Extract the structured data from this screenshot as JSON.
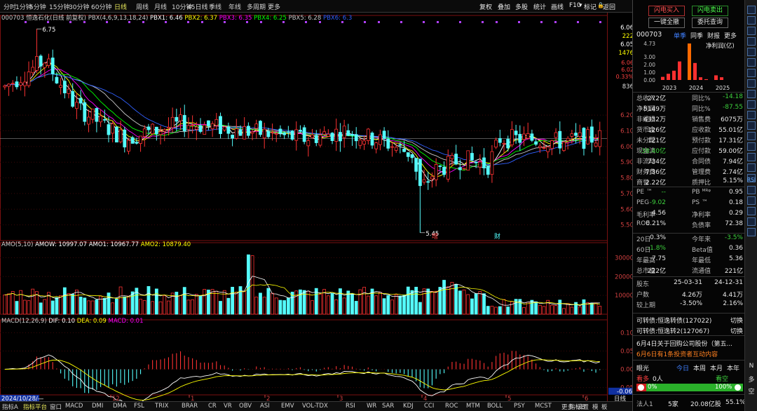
{
  "toolbar": {
    "periods": [
      "分时",
      "1分钟",
      "5分钟",
      "15分钟",
      "30分钟",
      "60分钟",
      "日线",
      "周线",
      "月线",
      "10分钟",
      "45日线",
      "季线",
      "年线",
      "多周期",
      "更多"
    ],
    "active_period": "日线",
    "right_buttons": [
      "复权",
      "叠加",
      "多股",
      "统计",
      "画线",
      "F10",
      "标记",
      "返回"
    ],
    "lock_icon": "lock-icon",
    "f10_dropdown": "▾"
  },
  "price_legend": {
    "stock": "000703 恒逸石化(日线 前复权)",
    "indicator": "PBX(4,6,9,13,18,24)",
    "pbx1": "PBX1: 6.46",
    "pbx2": "PBX2: 6.37",
    "pbx3": "PBX3: 6.35",
    "pbx4": "PBX4: 6.25",
    "pbx5": "PBX5: 6.28",
    "pbx6": "PBX6: 6.3"
  },
  "price_axis": {
    "labels": [
      "6.06",
      "222",
      "6.05",
      "1476",
      "6.20",
      "6.10",
      "6.00",
      "5.90",
      "5.80",
      "5.70",
      "5.60",
      "5.50"
    ],
    "top_values": [
      "6.06",
      "222",
      "6.05",
      "1476"
    ],
    "mini_changes": [
      "6.06",
      "6.02",
      "0.33%"
    ],
    "scale": "836"
  },
  "price_annotations": {
    "high": "6.75",
    "low": "5.45",
    "marker1": "增",
    "marker2": "财"
  },
  "amo_legend": {
    "name": "AMO(5,10)",
    "amow": "AMOW: 10997.07",
    "amo1": "AMO1: 10967.77",
    "amo2": "AMO2: 10879.40"
  },
  "amo_axis": [
    "30000",
    "20000",
    "10000"
  ],
  "macd_legend": {
    "name": "MACD(12,26,9)",
    "dif": "DIF: 0.10",
    "dea": "DEA: 0.09",
    "macd": "MACD: 0.01"
  },
  "macd_axis": [
    "0.10",
    "0.05",
    "0.00",
    "-0.05",
    "-0.06"
  ],
  "date_axis": {
    "start": "2024/10/28/—",
    "months": [
      "12",
      "1",
      "2",
      "3",
      "4",
      "5",
      "6"
    ],
    "label": "日线"
  },
  "bottom_tabs": [
    "指标A",
    "指标平台",
    "窗口",
    "MACD",
    "DMI",
    "DMA",
    "FSL",
    "TRIX",
    "BRAR",
    "CR",
    "VR",
    "OBV",
    "ASI",
    "EMV",
    "VOL-TDX",
    "RSI",
    "WR",
    "SAR",
    "KDJ",
    "CCI",
    "ROC",
    "MTM",
    "BOLL",
    "PSY",
    "MCST",
    "更多",
    "设置"
  ],
  "bottom_right": [
    "指标B",
    "模",
    "板"
  ],
  "colors": {
    "up": "#ff3232",
    "down": "#54fcfc",
    "ma_white": "#ffffff",
    "ma_yellow": "#ffff00",
    "ma_magenta": "#ff00ff",
    "ma_green": "#00ff00",
    "ma_blue": "#3060ff",
    "grid": "#7a1010"
  },
  "right_panel": {
    "trade_buy": "闪电买入",
    "trade_sell": "闪电卖出",
    "one_key": "一键全撤",
    "query": "委托查询",
    "code": "000703",
    "tabs": [
      "单季",
      "同季",
      "财报",
      "更多"
    ],
    "chart_title": "净利润(亿)",
    "chart_y": [
      "4.73",
      "3.00",
      "2.00",
      "1.00",
      "0.00"
    ],
    "chart_years": [
      "2023",
      "2024",
      "2025"
    ],
    "fin": [
      [
        "总收入",
        "272亿",
        "同比%",
        "-14.18"
      ],
      [
        "净利润",
        "5149万",
        "同比%",
        "-87.55"
      ],
      [
        "非经损",
        "4332万",
        "销售费",
        "6075万"
      ],
      [
        "货币金",
        "126亿",
        "应收款",
        "55.01亿"
      ],
      [
        "未分配",
        "121亿",
        "预付款",
        "17.31亿"
      ],
      [
        "现金流",
        "-38.40亿",
        "应付款",
        "59.00亿"
      ],
      [
        "非流动",
        "734亿",
        "合同债",
        "7.94亿"
      ],
      [
        "财务费",
        "7.36亿",
        "管理费",
        "2.74亿"
      ],
      [
        "商誉",
        "2.22亿",
        "质押比",
        "5.15%"
      ]
    ],
    "ratios": [
      [
        "PE ™",
        "--",
        "PB ᴹᴿᵠ",
        "0.95"
      ],
      [
        "PEG",
        "-9.02",
        "PS ™",
        "0.18"
      ],
      [
        "毛利率",
        "4.56",
        "净利率",
        "0.29"
      ],
      [
        "ROE",
        "0.21%",
        "负债率",
        "72.38"
      ]
    ],
    "perf": [
      [
        "20日",
        "0.3%",
        "今年来",
        "-3.5%"
      ],
      [
        "60日",
        "-1.8%",
        "Beta值",
        "0.36"
      ],
      [
        "年最高",
        "7.75",
        "年最低",
        "5.36"
      ],
      [
        "总市值",
        "222亿",
        "流通值",
        "221亿"
      ]
    ],
    "holders": [
      [
        "股东",
        "25-03-31",
        "24-12-31"
      ],
      [
        "户数",
        "4.26万",
        "4.41万"
      ],
      [
        "较上期",
        "-3.50%",
        "2.16%"
      ]
    ],
    "bonds": [
      [
        "可转债:恒逸转债(127022)",
        "切换"
      ],
      [
        "可转债:恒逸转2(127067)",
        "切换"
      ]
    ],
    "news": [
      "6月4日关于回购公司股份（第五...",
      "6月6日有1条投资者互动内容"
    ],
    "sentiment_title": "眼光",
    "sentiment_tabs": [
      "今日",
      "本周",
      "本月",
      "本年"
    ],
    "bull_label": "看多",
    "bull_count": "0人",
    "bear_label": "看空",
    "bull_pct": "0%",
    "bear_pct": "100%",
    "bull_pct_num": 0,
    "bear_pct_num": 100,
    "footer": [
      "法人1",
      "5家",
      "20.08亿股",
      "55.1%"
    ]
  },
  "side_strip": {
    "labels": [
      "RSI",
      "N",
      "多",
      "空"
    ]
  }
}
